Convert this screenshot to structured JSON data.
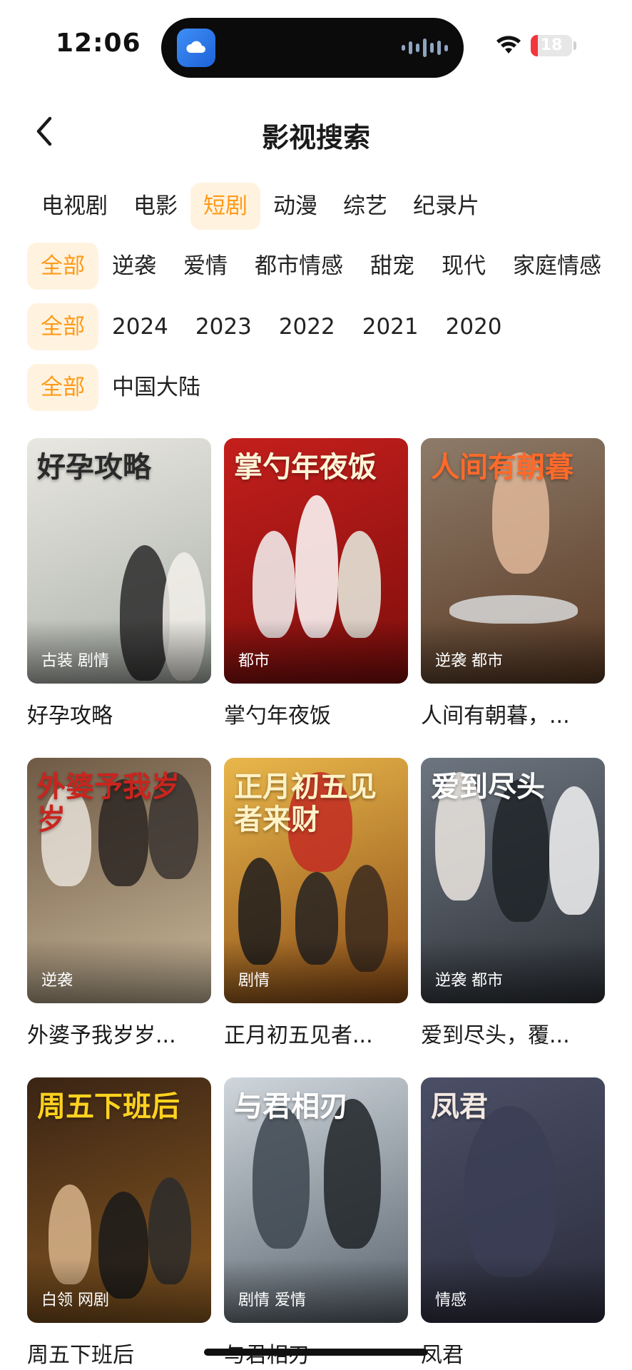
{
  "status_bar": {
    "time": "12:06",
    "battery": "18",
    "battery_fraction": 0.18,
    "icons": [
      "cloud-app-icon",
      "audio-wave-icon",
      "wifi-icon",
      "battery-icon"
    ],
    "battery_color": "#f1363c"
  },
  "header": {
    "title": "影视搜索",
    "back_icon": "chevron-left-icon"
  },
  "accent_color": "#ff9a1a",
  "accent_bg": "#fff3e0",
  "filters": {
    "category": [
      {
        "label": "电视剧",
        "active": false
      },
      {
        "label": "电影",
        "active": false
      },
      {
        "label": "短剧",
        "active": true
      },
      {
        "label": "动漫",
        "active": false
      },
      {
        "label": "综艺",
        "active": false
      },
      {
        "label": "纪录片",
        "active": false
      }
    ],
    "genre": [
      {
        "label": "全部",
        "active": true
      },
      {
        "label": "逆袭",
        "active": false
      },
      {
        "label": "爱情",
        "active": false
      },
      {
        "label": "都市情感",
        "active": false
      },
      {
        "label": "甜宠",
        "active": false
      },
      {
        "label": "现代",
        "active": false
      },
      {
        "label": "家庭情感",
        "active": false
      }
    ],
    "year": [
      {
        "label": "全部",
        "active": true
      },
      {
        "label": "2024",
        "active": false
      },
      {
        "label": "2023",
        "active": false
      },
      {
        "label": "2022",
        "active": false
      },
      {
        "label": "2021",
        "active": false
      },
      {
        "label": "2020",
        "active": false
      }
    ],
    "region": [
      {
        "label": "全部",
        "active": true
      },
      {
        "label": "中国大陆",
        "active": false
      }
    ]
  },
  "results": [
    {
      "title": "好孕攻略",
      "tags": "古装 剧情",
      "poster_text": "好孕攻略",
      "poster_colors": [
        "#e9e7e1",
        "#a9b0a8"
      ],
      "poster_text_color": "#2a2a2a"
    },
    {
      "title": "掌勺年夜饭",
      "tags": "都市",
      "poster_text": "掌勺年夜饭",
      "poster_colors": [
        "#c41f1c",
        "#7e0e0c"
      ],
      "poster_text_color": "#fff4d8"
    },
    {
      "title": "人间有朝暮，...",
      "tags": "逆袭 都市",
      "poster_text": "人间有朝暮",
      "poster_colors": [
        "#8d7b69",
        "#5a3a24"
      ],
      "poster_text_color": "#ff6a2a"
    },
    {
      "title": "外婆予我岁岁...",
      "tags": "逆袭",
      "poster_text": "外婆予我岁岁",
      "poster_colors": [
        "#6f5a45",
        "#c9b89b"
      ],
      "poster_text_color": "#c8251e"
    },
    {
      "title": "正月初五见者...",
      "tags": "剧情",
      "poster_text": "正月初五见者来财",
      "poster_colors": [
        "#e9b74b",
        "#8a4b16"
      ],
      "poster_text_color": "#fff2c6"
    },
    {
      "title": "爱到尽头，覆...",
      "tags": "逆袭 都市",
      "poster_text": "爱到尽头",
      "poster_colors": [
        "#6d7580",
        "#2e3238"
      ],
      "poster_text_color": "#ffffff"
    },
    {
      "title": "周五下班后",
      "tags": "白领 网剧",
      "poster_text": "周五下班后",
      "poster_colors": [
        "#3a2414",
        "#8a5a22"
      ],
      "poster_text_color": "#ffd21f"
    },
    {
      "title": "与君相刃",
      "tags": "剧情 爱情",
      "poster_text": "与君相刃",
      "poster_colors": [
        "#cfd6dc",
        "#59636d"
      ],
      "poster_text_color": "#ffffff"
    },
    {
      "title": "凤君",
      "tags": "情感",
      "poster_text": "凤君",
      "poster_colors": [
        "#4b4f66",
        "#2c2d3d"
      ],
      "poster_text_color": "#f3e9e2"
    }
  ]
}
